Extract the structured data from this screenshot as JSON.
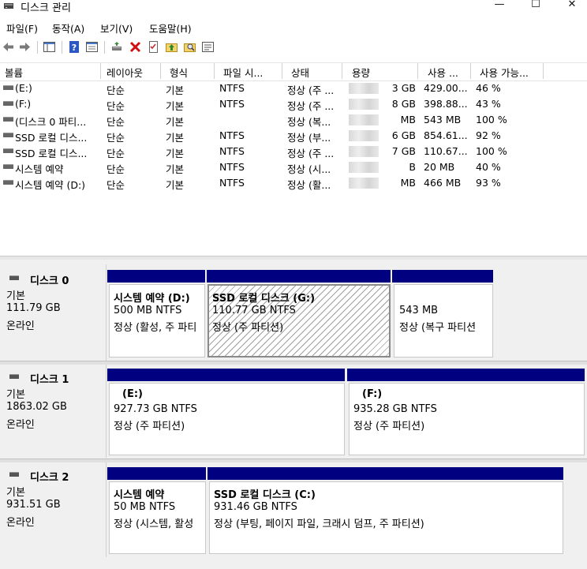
{
  "window": {
    "title": "디스크 관리",
    "controls": {
      "minimize": "—",
      "maximize": "☐",
      "close": "✕"
    }
  },
  "menu": [
    "파일(F)",
    "동작(A)",
    "보기(V)",
    "도움말(H)"
  ],
  "toolbar_icons": [
    "back-arrow-icon",
    "forward-arrow-icon",
    "show-hide-tree-icon",
    "help-icon",
    "properties-icon",
    "connect-drive-icon",
    "delete-icon",
    "checklist-icon",
    "up-folder-icon",
    "search-folder-icon",
    "rescan-icon"
  ],
  "list": {
    "columns": [
      "볼륨",
      "레이아웃",
      "형식",
      "파일 시...",
      "상태",
      "용량",
      "사용 ...",
      "사용 가능..."
    ],
    "rows": [
      {
        "volume": "(E:)",
        "layout": "단순",
        "type": "기본",
        "fs": "NTFS",
        "status": "정상 (주 ...",
        "capacity": "3 GB",
        "free": "429.00...",
        "pct": "46 %"
      },
      {
        "volume": "(F:)",
        "layout": "단순",
        "type": "기본",
        "fs": "NTFS",
        "status": "정상 (주 ...",
        "capacity": "8 GB",
        "free": "398.88...",
        "pct": "43 %"
      },
      {
        "volume": "(디스크 0 파티...",
        "layout": "단순",
        "type": "기본",
        "fs": "",
        "status": "정상 (복...",
        "capacity": "MB",
        "free": "543 MB",
        "pct": "100 %"
      },
      {
        "volume": "SSD 로컬 디스...",
        "layout": "단순",
        "type": "기본",
        "fs": "NTFS",
        "status": "정상 (부...",
        "capacity": "6 GB",
        "free": "854.61...",
        "pct": "92 %"
      },
      {
        "volume": "SSD 로컬 디스...",
        "layout": "단순",
        "type": "기본",
        "fs": "NTFS",
        "status": "정상 (주 ...",
        "capacity": "7 GB",
        "free": "110.67...",
        "pct": "100 %"
      },
      {
        "volume": "시스템 예약",
        "layout": "단순",
        "type": "기본",
        "fs": "NTFS",
        "status": "정상 (시...",
        "capacity": "B",
        "free": "20 MB",
        "pct": "40 %"
      },
      {
        "volume": "시스템 예약 (D:)",
        "layout": "단순",
        "type": "기본",
        "fs": "NTFS",
        "status": "정상 (활...",
        "capacity": "MB",
        "free": "466 MB",
        "pct": "93 %"
      }
    ]
  },
  "disks": [
    {
      "name": "디스크 0",
      "type": "기본",
      "size": "111.79 GB",
      "state": "온라인",
      "partitions": [
        {
          "title": "시스템 예약  (D:)",
          "size": "500 MB NTFS",
          "status": "정상 (활성, 주 파티"
        },
        {
          "title": "SSD 로컬 디스크  (G:)",
          "size": "110.77 GB NTFS",
          "status": "정상 (주 파티션)"
        },
        {
          "title": "",
          "size": "543 MB",
          "status": "정상 (복구 파티션"
        }
      ]
    },
    {
      "name": "디스크 1",
      "type": "기본",
      "size": "1863.02 GB",
      "state": "온라인",
      "partitions": [
        {
          "title": "(E:)",
          "size": "927.73 GB NTFS",
          "status": "정상 (주 파티션)"
        },
        {
          "title": "(F:)",
          "size": "935.28 GB NTFS",
          "status": "정상 (주 파티션)"
        }
      ]
    },
    {
      "name": "디스크 2",
      "type": "기본",
      "size": "931.51 GB",
      "state": "온라인",
      "partitions": [
        {
          "title": "시스템 예약",
          "size": "50 MB NTFS",
          "status": "정상 (시스템, 활성"
        },
        {
          "title": "SSD 로컬 디스크  (C:)",
          "size": "931.46 GB NTFS",
          "status": "정상 (부팅, 페이지 파일, 크래시 덤프, 주 파티션)"
        }
      ]
    }
  ],
  "colors": {
    "partition_bar": "#000080"
  }
}
